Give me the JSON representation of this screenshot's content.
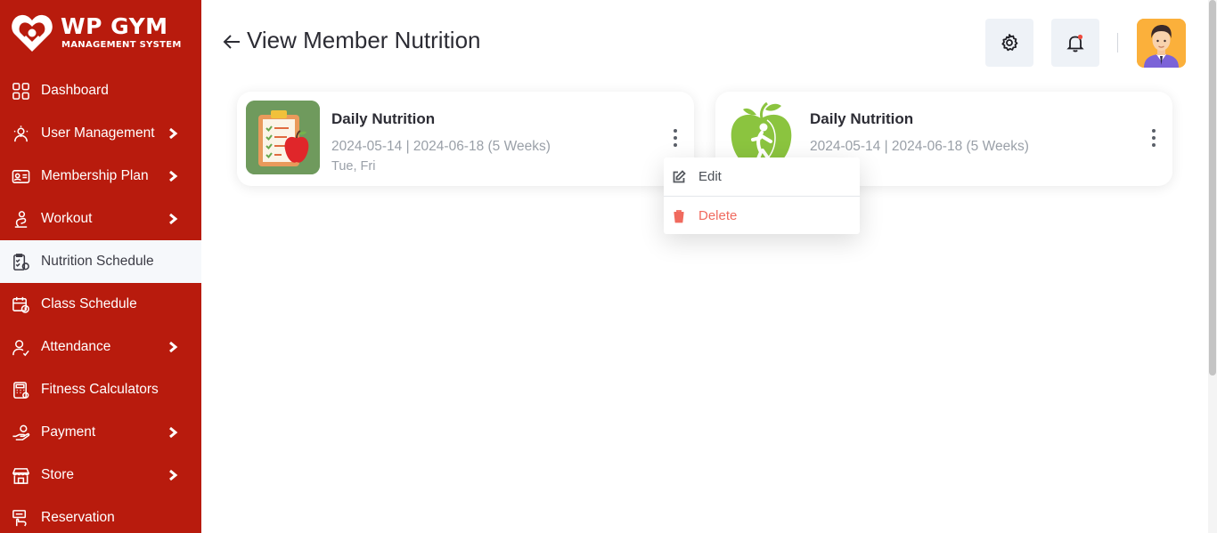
{
  "brand": {
    "name": "WP GYM",
    "subtitle": "MANAGEMENT SYSTEM",
    "primary_color": "#b81b0d"
  },
  "sidebar": {
    "items": [
      {
        "label": "Dashboard",
        "icon": "grid-icon",
        "has_chevron": false,
        "active": false
      },
      {
        "label": "User Management",
        "icon": "users-gear-icon",
        "has_chevron": true,
        "active": false
      },
      {
        "label": "Membership Plan",
        "icon": "id-card-icon",
        "has_chevron": true,
        "active": false
      },
      {
        "label": "Workout",
        "icon": "workout-icon",
        "has_chevron": true,
        "active": false
      },
      {
        "label": "Nutrition Schedule",
        "icon": "nutrition-icon",
        "has_chevron": false,
        "active": true
      },
      {
        "label": "Class Schedule",
        "icon": "calendar-clock-icon",
        "has_chevron": false,
        "active": false
      },
      {
        "label": "Attendance",
        "icon": "user-check-icon",
        "has_chevron": true,
        "active": false
      },
      {
        "label": "Fitness Calculators",
        "icon": "calculator-icon",
        "has_chevron": false,
        "active": false
      },
      {
        "label": "Payment",
        "icon": "hand-coin-icon",
        "has_chevron": true,
        "active": false
      },
      {
        "label": "Store",
        "icon": "store-icon",
        "has_chevron": true,
        "active": false
      },
      {
        "label": "Reservation",
        "icon": "reservation-icon",
        "has_chevron": false,
        "active": false
      }
    ]
  },
  "header": {
    "title": "View Member Nutrition",
    "settings_icon": "gear-icon",
    "notification_icon": "bell-icon",
    "notification_dot_color": "#ef4b3f"
  },
  "cards": [
    {
      "title": "Daily Nutrition",
      "dates": "2024-05-14 | 2024-06-18 (5 Weeks)",
      "days": "Tue, Fri",
      "thumbnail": "clipboard-apple-icon"
    },
    {
      "title": "Daily Nutrition",
      "dates": "2024-05-14 | 2024-06-18 (5 Weeks)",
      "days": "",
      "thumbnail": "green-apple-icon"
    }
  ],
  "dropdown": {
    "edit_label": "Edit",
    "delete_label": "Delete",
    "delete_color": "#f06a5e"
  }
}
